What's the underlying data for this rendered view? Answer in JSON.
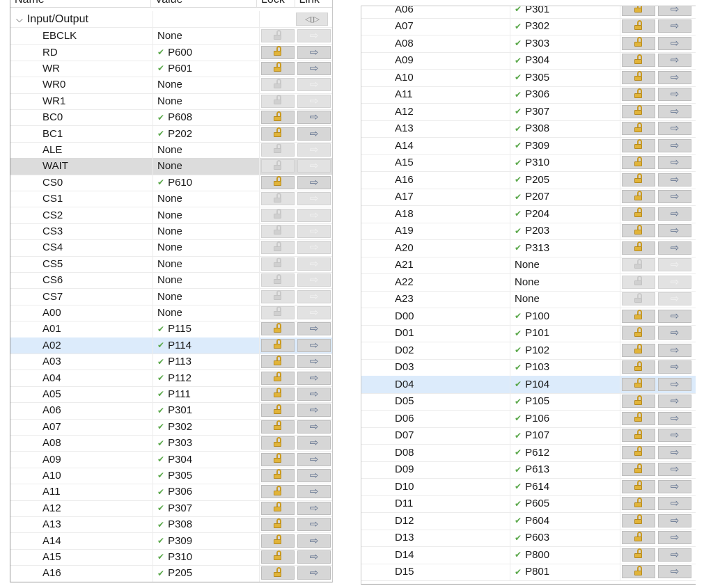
{
  "left_panel": {
    "header": {
      "name": "Name",
      "value": "Value",
      "lock": "Lock",
      "link": "Link"
    },
    "group": {
      "label": "Input/Output",
      "chevron_icon": "chevron-down-icon",
      "nav_icon": "nav-arrows-icon"
    },
    "rows": [
      {
        "name": "EBCLK",
        "value": "None",
        "has_check": false,
        "enabled": false,
        "highlight": ""
      },
      {
        "name": "RD",
        "value": "P600",
        "has_check": true,
        "enabled": true,
        "highlight": ""
      },
      {
        "name": "WR",
        "value": "P601",
        "has_check": true,
        "enabled": true,
        "highlight": ""
      },
      {
        "name": "WR0",
        "value": "None",
        "has_check": false,
        "enabled": false,
        "highlight": ""
      },
      {
        "name": "WR1",
        "value": "None",
        "has_check": false,
        "enabled": false,
        "highlight": ""
      },
      {
        "name": "BC0",
        "value": "P608",
        "has_check": true,
        "enabled": true,
        "highlight": ""
      },
      {
        "name": "BC1",
        "value": "P202",
        "has_check": true,
        "enabled": true,
        "highlight": ""
      },
      {
        "name": "ALE",
        "value": "None",
        "has_check": false,
        "enabled": false,
        "highlight": ""
      },
      {
        "name": "WAIT",
        "value": "None",
        "has_check": false,
        "enabled": false,
        "highlight": "grey"
      },
      {
        "name": "CS0",
        "value": "P610",
        "has_check": true,
        "enabled": true,
        "highlight": ""
      },
      {
        "name": "CS1",
        "value": "None",
        "has_check": false,
        "enabled": false,
        "highlight": ""
      },
      {
        "name": "CS2",
        "value": "None",
        "has_check": false,
        "enabled": false,
        "highlight": ""
      },
      {
        "name": "CS3",
        "value": "None",
        "has_check": false,
        "enabled": false,
        "highlight": ""
      },
      {
        "name": "CS4",
        "value": "None",
        "has_check": false,
        "enabled": false,
        "highlight": ""
      },
      {
        "name": "CS5",
        "value": "None",
        "has_check": false,
        "enabled": false,
        "highlight": ""
      },
      {
        "name": "CS6",
        "value": "None",
        "has_check": false,
        "enabled": false,
        "highlight": ""
      },
      {
        "name": "CS7",
        "value": "None",
        "has_check": false,
        "enabled": false,
        "highlight": ""
      },
      {
        "name": "A00",
        "value": "None",
        "has_check": false,
        "enabled": false,
        "highlight": ""
      },
      {
        "name": "A01",
        "value": "P115",
        "has_check": true,
        "enabled": true,
        "highlight": ""
      },
      {
        "name": "A02",
        "value": "P114",
        "has_check": true,
        "enabled": true,
        "highlight": "sel"
      },
      {
        "name": "A03",
        "value": "P113",
        "has_check": true,
        "enabled": true,
        "highlight": ""
      },
      {
        "name": "A04",
        "value": "P112",
        "has_check": true,
        "enabled": true,
        "highlight": ""
      },
      {
        "name": "A05",
        "value": "P111",
        "has_check": true,
        "enabled": true,
        "highlight": ""
      },
      {
        "name": "A06",
        "value": "P301",
        "has_check": true,
        "enabled": true,
        "highlight": ""
      },
      {
        "name": "A07",
        "value": "P302",
        "has_check": true,
        "enabled": true,
        "highlight": ""
      },
      {
        "name": "A08",
        "value": "P303",
        "has_check": true,
        "enabled": true,
        "highlight": ""
      },
      {
        "name": "A09",
        "value": "P304",
        "has_check": true,
        "enabled": true,
        "highlight": ""
      },
      {
        "name": "A10",
        "value": "P305",
        "has_check": true,
        "enabled": true,
        "highlight": ""
      },
      {
        "name": "A11",
        "value": "P306",
        "has_check": true,
        "enabled": true,
        "highlight": ""
      },
      {
        "name": "A12",
        "value": "P307",
        "has_check": true,
        "enabled": true,
        "highlight": ""
      },
      {
        "name": "A13",
        "value": "P308",
        "has_check": true,
        "enabled": true,
        "highlight": ""
      },
      {
        "name": "A14",
        "value": "P309",
        "has_check": true,
        "enabled": true,
        "highlight": ""
      },
      {
        "name": "A15",
        "value": "P310",
        "has_check": true,
        "enabled": true,
        "highlight": ""
      },
      {
        "name": "A16",
        "value": "P205",
        "has_check": true,
        "enabled": true,
        "highlight": ""
      }
    ]
  },
  "right_panel": {
    "rows": [
      {
        "name": "A06",
        "value": "P301",
        "has_check": true,
        "enabled": true,
        "highlight": ""
      },
      {
        "name": "A07",
        "value": "P302",
        "has_check": true,
        "enabled": true,
        "highlight": ""
      },
      {
        "name": "A08",
        "value": "P303",
        "has_check": true,
        "enabled": true,
        "highlight": ""
      },
      {
        "name": "A09",
        "value": "P304",
        "has_check": true,
        "enabled": true,
        "highlight": ""
      },
      {
        "name": "A10",
        "value": "P305",
        "has_check": true,
        "enabled": true,
        "highlight": ""
      },
      {
        "name": "A11",
        "value": "P306",
        "has_check": true,
        "enabled": true,
        "highlight": ""
      },
      {
        "name": "A12",
        "value": "P307",
        "has_check": true,
        "enabled": true,
        "highlight": ""
      },
      {
        "name": "A13",
        "value": "P308",
        "has_check": true,
        "enabled": true,
        "highlight": ""
      },
      {
        "name": "A14",
        "value": "P309",
        "has_check": true,
        "enabled": true,
        "highlight": ""
      },
      {
        "name": "A15",
        "value": "P310",
        "has_check": true,
        "enabled": true,
        "highlight": ""
      },
      {
        "name": "A16",
        "value": "P205",
        "has_check": true,
        "enabled": true,
        "highlight": ""
      },
      {
        "name": "A17",
        "value": "P207",
        "has_check": true,
        "enabled": true,
        "highlight": ""
      },
      {
        "name": "A18",
        "value": "P204",
        "has_check": true,
        "enabled": true,
        "highlight": ""
      },
      {
        "name": "A19",
        "value": "P203",
        "has_check": true,
        "enabled": true,
        "highlight": ""
      },
      {
        "name": "A20",
        "value": "P313",
        "has_check": true,
        "enabled": true,
        "highlight": ""
      },
      {
        "name": "A21",
        "value": "None",
        "has_check": false,
        "enabled": false,
        "highlight": ""
      },
      {
        "name": "A22",
        "value": "None",
        "has_check": false,
        "enabled": false,
        "highlight": ""
      },
      {
        "name": "A23",
        "value": "None",
        "has_check": false,
        "enabled": false,
        "highlight": ""
      },
      {
        "name": "D00",
        "value": "P100",
        "has_check": true,
        "enabled": true,
        "highlight": ""
      },
      {
        "name": "D01",
        "value": "P101",
        "has_check": true,
        "enabled": true,
        "highlight": ""
      },
      {
        "name": "D02",
        "value": "P102",
        "has_check": true,
        "enabled": true,
        "highlight": ""
      },
      {
        "name": "D03",
        "value": "P103",
        "has_check": true,
        "enabled": true,
        "highlight": ""
      },
      {
        "name": "D04",
        "value": "P104",
        "has_check": true,
        "enabled": true,
        "highlight": "sel"
      },
      {
        "name": "D05",
        "value": "P105",
        "has_check": true,
        "enabled": true,
        "highlight": ""
      },
      {
        "name": "D06",
        "value": "P106",
        "has_check": true,
        "enabled": true,
        "highlight": ""
      },
      {
        "name": "D07",
        "value": "P107",
        "has_check": true,
        "enabled": true,
        "highlight": ""
      },
      {
        "name": "D08",
        "value": "P612",
        "has_check": true,
        "enabled": true,
        "highlight": ""
      },
      {
        "name": "D09",
        "value": "P613",
        "has_check": true,
        "enabled": true,
        "highlight": ""
      },
      {
        "name": "D10",
        "value": "P614",
        "has_check": true,
        "enabled": true,
        "highlight": ""
      },
      {
        "name": "D11",
        "value": "P605",
        "has_check": true,
        "enabled": true,
        "highlight": ""
      },
      {
        "name": "D12",
        "value": "P604",
        "has_check": true,
        "enabled": true,
        "highlight": ""
      },
      {
        "name": "D13",
        "value": "P603",
        "has_check": true,
        "enabled": true,
        "highlight": ""
      },
      {
        "name": "D14",
        "value": "P800",
        "has_check": true,
        "enabled": true,
        "highlight": ""
      },
      {
        "name": "D15",
        "value": "P801",
        "has_check": true,
        "enabled": true,
        "highlight": ""
      }
    ]
  },
  "icons": {
    "check": "check-icon",
    "lock": "lock-icon",
    "link": "arrow-right-icon"
  },
  "colors": {
    "check": "#5aa84a",
    "lock": "#e1b43a",
    "selected_row": "#dcebfb",
    "grey_row": "#dcdcdc"
  }
}
